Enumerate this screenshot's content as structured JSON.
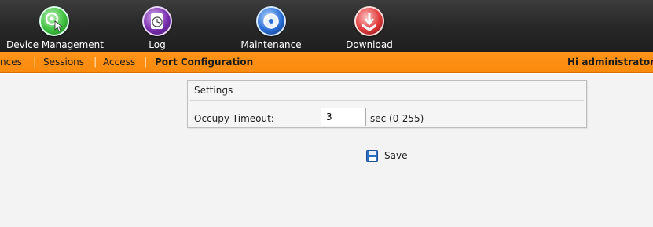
{
  "toolbar": {
    "items": [
      {
        "label": "Device Management",
        "icon": "device-management-icon"
      },
      {
        "label": "Log",
        "icon": "log-icon"
      },
      {
        "label": "Maintenance",
        "icon": "maintenance-icon"
      },
      {
        "label": "Download",
        "icon": "download-icon"
      }
    ]
  },
  "nav": {
    "items": [
      {
        "label": "nces"
      },
      {
        "label": "Sessions"
      },
      {
        "label": "Access"
      },
      {
        "label": "Port Configuration"
      }
    ],
    "separator": "|",
    "greeting": "Hi administrator,"
  },
  "settings": {
    "title": "Settings",
    "occupy_timeout_label": "Occupy Timeout:",
    "occupy_timeout_value": "3",
    "occupy_timeout_hint": "sec (0-255)"
  },
  "save": {
    "label": "Save",
    "icon": "floppy-disk-icon"
  },
  "colors": {
    "toolbar_bg": "#2a2a2a",
    "nav_bg": "#f98a0c",
    "content_bg": "#f3f3f3"
  }
}
